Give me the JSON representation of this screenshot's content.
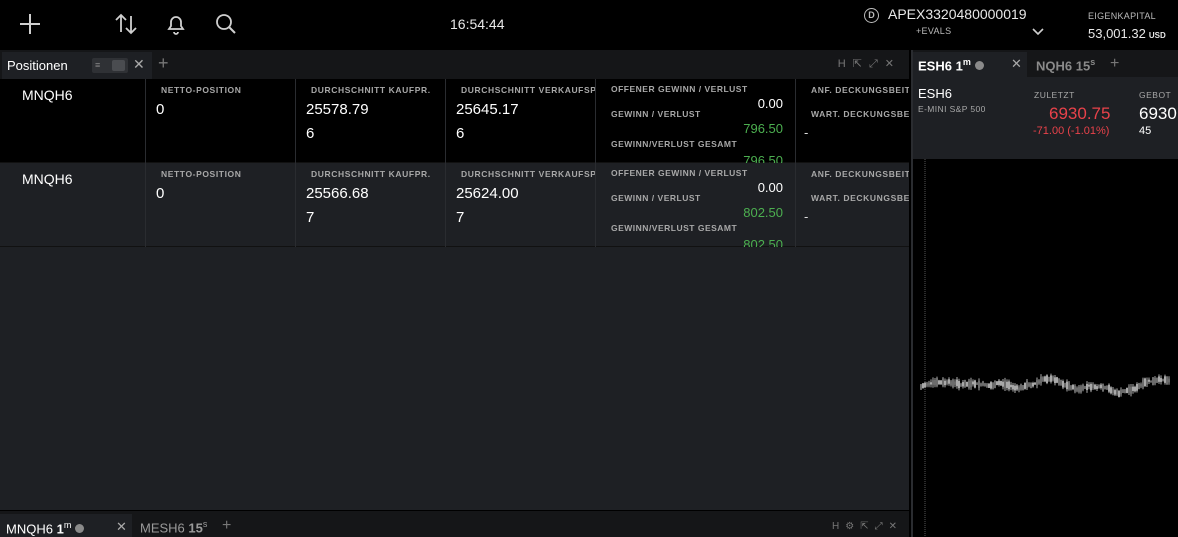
{
  "topbar": {
    "icons": [
      "add-icon",
      "transfer-icon",
      "bell-icon",
      "search-icon"
    ],
    "clock": "16:54:44",
    "account_badge": "D",
    "account_id": "APEX3320480000019",
    "account_sub": "+EVALS",
    "equity_label": "EIGENKAPITAL",
    "equity_value": "53,001.32",
    "equity_currency": "USD"
  },
  "positions_panel": {
    "tab_label": "Positionen",
    "tools": "H",
    "rows": [
      {
        "symbol": "MNQH6",
        "net_label": "NETTO-POSITION",
        "net_value": "0",
        "buy_label": "DURCHSCHNITT KAUFPR.",
        "buy_price": "25578.79",
        "buy_qty": "6",
        "sell_label": "DURCHSCHNITT VERKAUFSPR.",
        "sell_price": "25645.17",
        "sell_qty": "6",
        "open_pnl_label": "OFFENER GEWINN / VERLUST",
        "open_pnl": "0.00",
        "pnl_label": "GEWINN / VERLUST",
        "pnl": "796.50",
        "total_pnl_label": "GEWINN/VERLUST GESAMT",
        "total_pnl": "796.50",
        "margin_label": "ANF. DECKUNGSBEITRAG",
        "wait_margin_label": "WART. DECKUNGSBEITRAG",
        "margin_value": "-"
      },
      {
        "symbol": "MNQH6",
        "net_label": "NETTO-POSITION",
        "net_value": "0",
        "buy_label": "DURCHSCHNITT KAUFPR.",
        "buy_price": "25566.68",
        "buy_qty": "7",
        "sell_label": "DURCHSCHNITT VERKAUFSPR.",
        "sell_price": "25624.00",
        "sell_qty": "7",
        "open_pnl_label": "OFFENER GEWINN / VERLUST",
        "open_pnl": "0.00",
        "pnl_label": "GEWINN / VERLUST",
        "pnl": "802.50",
        "total_pnl_label": "GEWINN/VERLUST GESAMT",
        "total_pnl": "802.50",
        "margin_label": "ANF. DECKUNGSBEITRAG",
        "wait_margin_label": "WART. DECKUNGSBEITRAG",
        "margin_value": "-"
      }
    ]
  },
  "bottom_tabs": {
    "active_symbol": "MNQH6",
    "active_interval": "1",
    "active_unit": "m",
    "second_symbol": "MESH6",
    "second_interval": "15",
    "second_unit": "s",
    "tools": "H"
  },
  "right_panel": {
    "active_symbol": "ESH6",
    "active_interval": "1",
    "active_unit": "m",
    "second_symbol": "NQH6",
    "second_interval": "15",
    "second_unit": "s",
    "quote": {
      "symbol": "ESH6",
      "description": "E-MINI S&P 500",
      "last_label": "ZULETZT",
      "last": "6930.75",
      "change": "-71.00 (-1.01%)",
      "bid_label": "GEBOT",
      "bid": "6930",
      "bid_size": "45"
    }
  },
  "colors": {
    "background": "#000000",
    "panel": "#1e2024",
    "profit": "#4caf50",
    "loss": "#e8424a"
  }
}
